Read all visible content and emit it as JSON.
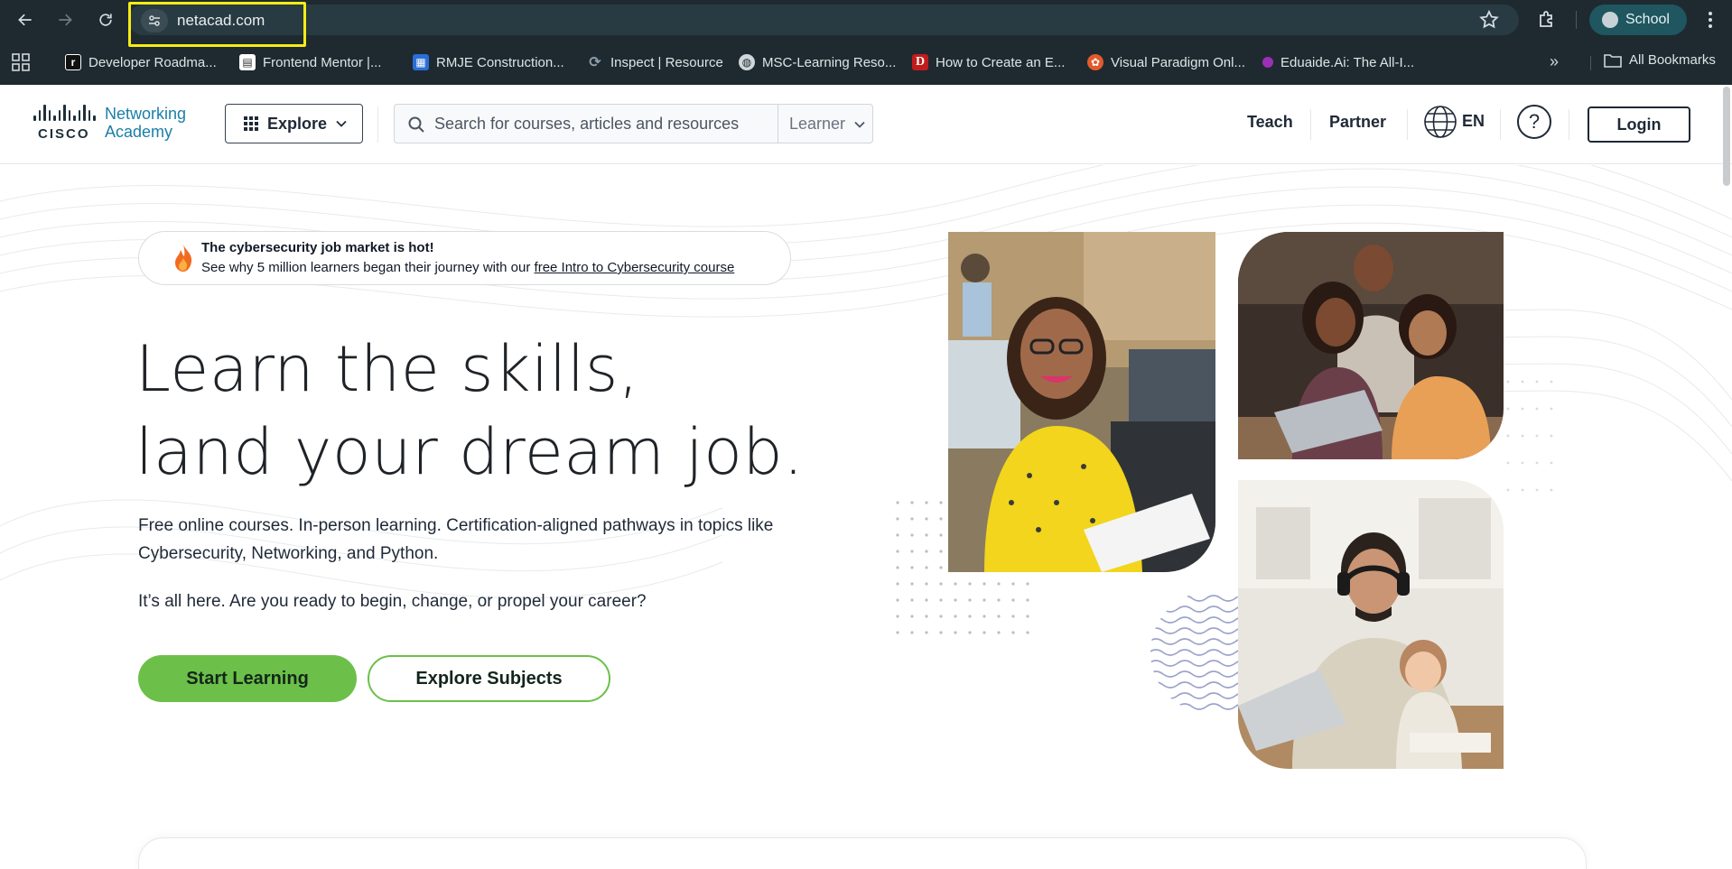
{
  "browser": {
    "url": "netacad.com",
    "profile_label": "School",
    "bookmarks": [
      {
        "label": "Developer Roadma...",
        "icon": "roadmap-favicon",
        "color": "#111111"
      },
      {
        "label": "Frontend Mentor |...",
        "icon": "frontend-mentor-favicon",
        "color": "#ffffff"
      },
      {
        "label": "RMJE Construction...",
        "icon": "rmje-favicon",
        "color": "#2a6fd6"
      },
      {
        "label": "Inspect | Resource",
        "icon": "inspect-favicon",
        "color": "#8fa0b0"
      },
      {
        "label": "MSC-Learning Reso...",
        "icon": "globe-favicon",
        "color": "#cfd7da"
      },
      {
        "label": "How to Create an E...",
        "icon": "d-favicon",
        "color": "#c21b1b"
      },
      {
        "label": "Visual Paradigm Onl...",
        "icon": "visual-paradigm-favicon",
        "color": "#e25a2c"
      },
      {
        "label": "Eduaide.Ai: The All-I...",
        "icon": "eduaide-favicon",
        "color": "#9b2fb8"
      }
    ],
    "all_bookmarks_label": "All Bookmarks"
  },
  "header": {
    "logo_brand": "CISCO",
    "logo_line1": "Networking",
    "logo_line2": "Academy",
    "explore_label": "Explore",
    "search_placeholder": "Search for courses, articles and resources",
    "audience_select": "Learner",
    "nav": [
      "Teach",
      "Partner"
    ],
    "language": "EN",
    "help_symbol": "?",
    "login_label": "Login"
  },
  "hero": {
    "banner_title": "The cybersecurity job market is hot!",
    "banner_text": "See why 5 million learners began their journey with our ",
    "banner_link": "free Intro to Cybersecurity course",
    "headline_line1": "Learn the skills,",
    "headline_line2": "land your dream job.",
    "lead": "Free online courses. In-person learning. Certification-aligned pathways in topics like Cybersecurity, Networking, and Python.",
    "lead2": "It’s all here. Are you ready to begin, change, or propel your career?",
    "primary_cta": "Start Learning",
    "secondary_cta": "Explore Subjects"
  },
  "colors": {
    "browser_frame": "#1e2a30",
    "url_highlight": "#f6eb14",
    "brand_blue": "#1b7fa6",
    "cta_green": "#6cc04a"
  }
}
